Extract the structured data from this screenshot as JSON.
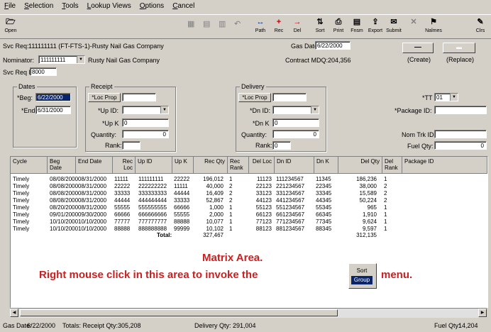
{
  "menu": [
    "File",
    "Selection",
    "Tools",
    "Lookup Views",
    "Options",
    "Cancel"
  ],
  "toolbar": {
    "open_label": "Open",
    "buttons": [
      {
        "label": "Path",
        "icon": "↔"
      },
      {
        "label": "Rec",
        "icon": "+"
      },
      {
        "label": "Del",
        "icon": "→"
      },
      {
        "label": "Sort",
        "icon": "⇅"
      },
      {
        "label": "Print",
        "icon": "⎙"
      },
      {
        "label": "Fnsm",
        "icon": "▤"
      },
      {
        "label": "Export",
        "icon": "⇪"
      },
      {
        "label": "Submit",
        "icon": "✉"
      },
      {
        "label": "",
        "icon": "✕"
      },
      {
        "label": "Nalmes",
        "icon": "⚑"
      },
      {
        "label": "Clrs",
        "icon": "✎"
      }
    ]
  },
  "header": {
    "svc_req_label": "Svc Req:",
    "svc_req_value": "111111111 (FT-FTS-1)-Rusty Nail Gas Company",
    "nominator_label": "Nominator:",
    "nominator_value": "111111111",
    "nominator_name": "Rusty Nail Gas Company",
    "svc_req_k_label": "Svc Req K:",
    "svc_req_k_value": "8000",
    "gas_date_label": "Gas Date:",
    "gas_date_value": "6/22/2000",
    "contract_mdq_label": "Contract MDQ:",
    "contract_mdq_value": "204,356",
    "create_label": "(Create)",
    "replace_label": "(Replace)"
  },
  "dates": {
    "title": "Dates",
    "beg_label": "*Beg:",
    "beg_value": "6/22/2000",
    "end_label": "*End:",
    "end_value": "6/31/2000"
  },
  "receipt": {
    "title": "Receipt",
    "loc_prop_label": "*Loc Prop",
    "up_id_label": "*Up ID:",
    "up_k_label": "*Up K",
    "up_k_value": "0",
    "quantity_label": "Quantity:",
    "quantity_value": "0",
    "rank_label": "Rank:"
  },
  "delivery": {
    "title": "Delivery",
    "loc_prop_label": "*Loc Prop",
    "dn_id_label": "*Dn ID:",
    "dn_k_label": "*Dn K",
    "dn_k_value": "0",
    "quantity_label": "Quantity:",
    "quantity_value": "0",
    "rank_label": "Rank:",
    "rank_value": "0"
  },
  "right": {
    "tt_label": "*TT",
    "tt_value": "01",
    "package_id_label": "*Package ID:",
    "nom_trk_label": "Nom Trk ID:",
    "fuel_qty_label": "Fuel Qty:",
    "fuel_qty_value": "0"
  },
  "grid": {
    "headers": [
      "Cycle",
      "Beg Date",
      "End Date",
      "Rec Loc",
      "Up ID",
      "Up K",
      "Rec Qty",
      "Rec Rank",
      "Del Loc",
      "Dn ID",
      "Dn K",
      "Del Qty",
      "Del Rank",
      "Package ID"
    ],
    "rows": [
      [
        "Timely",
        "08/08/2000",
        "08/31/2000",
        "11111",
        "111111111",
        "22222",
        "196,012",
        "1",
        "11123",
        "111234567",
        "11345",
        "186,236",
        "1",
        ""
      ],
      [
        "Timely",
        "08/08/2000",
        "08/31/2000",
        "22222",
        "222222222",
        "11111",
        "40,000",
        "2",
        "22123",
        "221234567",
        "22345",
        "38,000",
        "2",
        ""
      ],
      [
        "Timely",
        "08/08/2000",
        "08/31/2000",
        "33333",
        "333333333",
        "44444",
        "16,409",
        "2",
        "33123",
        "331234567",
        "33345",
        "15,589",
        "2",
        ""
      ],
      [
        "Timely",
        "08/08/2000",
        "08/31/2000",
        "44444",
        "444444444",
        "33333",
        "52,867",
        "2",
        "44123",
        "441234567",
        "44345",
        "50,224",
        "2",
        ""
      ],
      [
        "Timely",
        "08/20/2000",
        "08/31/2000",
        "55555",
        "555555555",
        "66666",
        "1,000",
        "1",
        "55123",
        "551234567",
        "55345",
        "965",
        "1",
        ""
      ],
      [
        "Timely",
        "09/01/2000",
        "09/30/2000",
        "66666",
        "666666666",
        "55555",
        "2,000",
        "1",
        "66123",
        "661234567",
        "66345",
        "1,910",
        "1",
        ""
      ],
      [
        "Timely",
        "10/10/2000",
        "10/10/2000",
        "77777",
        "777777777",
        "88888",
        "10,077",
        "1",
        "77123",
        "771234567",
        "77345",
        "9,624",
        "1",
        ""
      ],
      [
        "Timely",
        "10/10/2000",
        "10/10/2000",
        "88888",
        "888888888",
        "99999",
        "10,102",
        "1",
        "88123",
        "881234567",
        "88345",
        "9,597",
        "1",
        ""
      ]
    ],
    "total_label": "Total:",
    "total_rec": "327,467",
    "total_del": "312,135"
  },
  "overlay": {
    "line1": "Matrix Area.",
    "line2_pre": "Right mouse click in this area to invoke the",
    "menu_item1": "Sort",
    "menu_item2": "Group",
    "line2_post": "menu."
  },
  "status": {
    "gas_date_label": "Gas Date:",
    "gas_date_value": "6/22/2000",
    "totals_label": "Totals: Receipt Qty:",
    "receipt_qty": "305,208",
    "delivery_label": "Delivery Qty:",
    "delivery_qty": "291,004",
    "fuel_label": "Fuel Qty:",
    "fuel_qty": "14,204"
  }
}
